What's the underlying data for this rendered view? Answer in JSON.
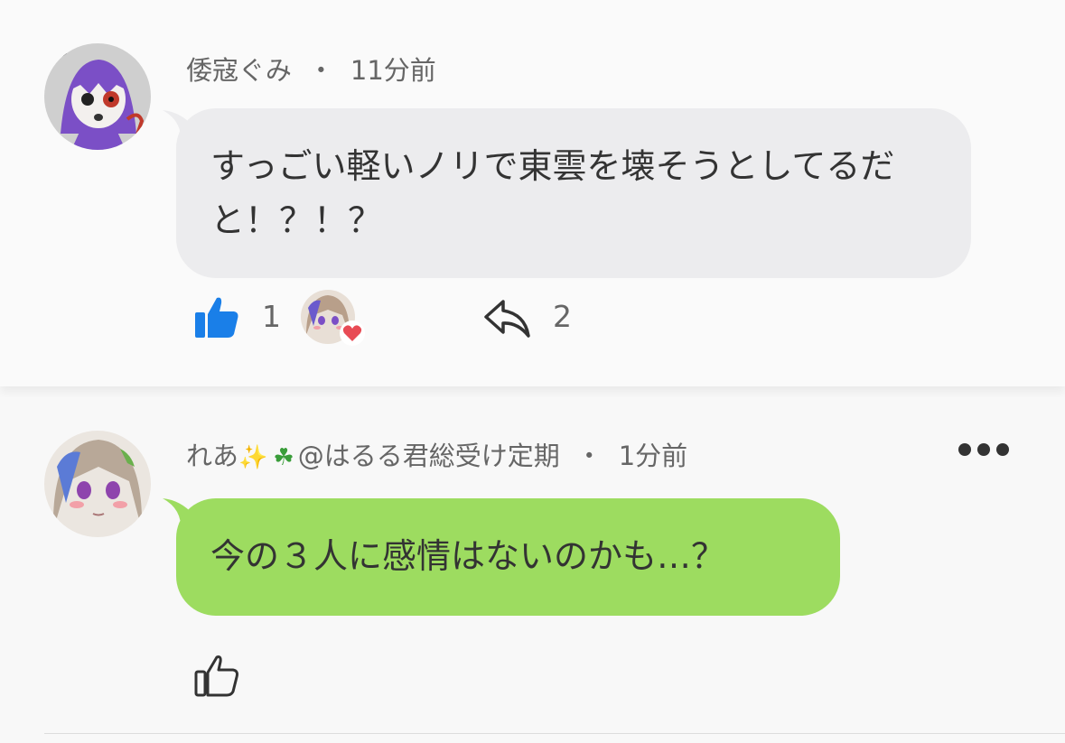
{
  "comments": [
    {
      "author": "倭寇ぐみ",
      "time": "11分前",
      "text": "すっごい軽いノリで東雲を壊そうとしてるだと！？！？",
      "like_count": "1",
      "reply_count": "2",
      "liked": true
    },
    {
      "author_prefix": "れあ",
      "author_suffix": "@はるる君総受け定期",
      "time": "1分前",
      "text": "今の３人に感情はないのかも…？",
      "liked": false
    }
  ],
  "meta_separator": "・",
  "colors": {
    "like_active": "#1a7fe8",
    "gray_bubble": "#ececee",
    "green_bubble": "#9ddc60",
    "heart": "#e84b55"
  }
}
